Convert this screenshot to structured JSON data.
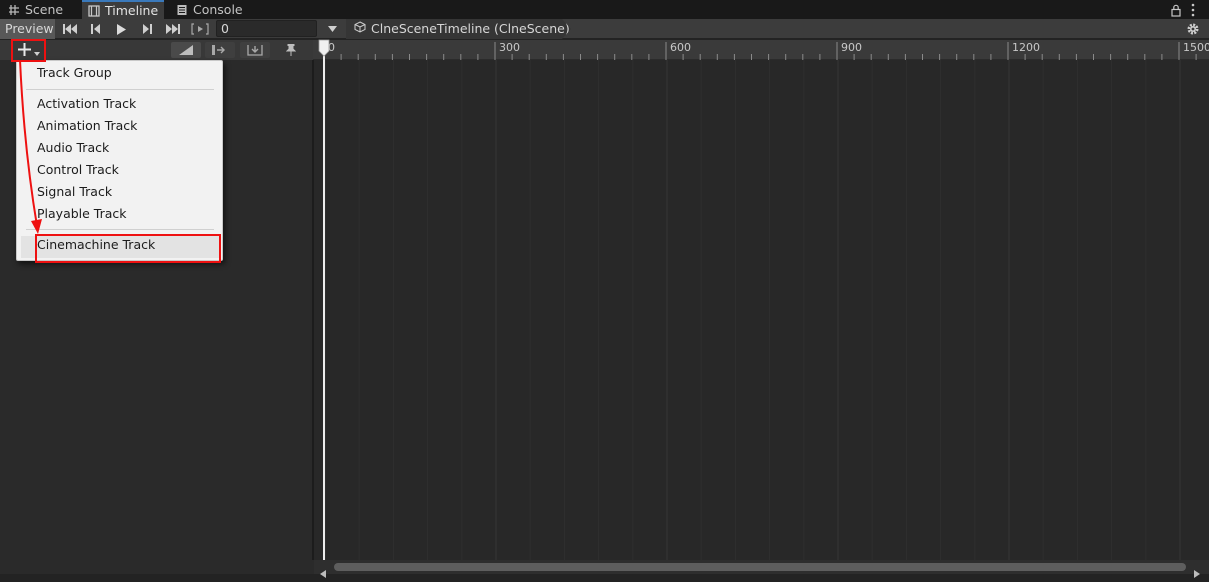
{
  "tabs": [
    {
      "label": "Scene",
      "icon": "grid-icon"
    },
    {
      "label": "Timeline",
      "icon": "film-icon",
      "active": true
    },
    {
      "label": "Console",
      "icon": "console-icon"
    }
  ],
  "toolbar": {
    "preview_label": "Preview",
    "frame_value": "0",
    "breadcrumb": "ClneSceneTimeline (ClneScene)",
    "icons": [
      "go-to-start-icon",
      "previous-frame-icon",
      "play-icon",
      "next-frame-icon",
      "go-to-end-icon",
      "play-range-icon",
      "dropdown-arrow-icon",
      "cube-icon",
      "gear-icon"
    ]
  },
  "ruler": {
    "ticks": [
      "0",
      "300",
      "600",
      "900",
      "1200",
      "1500"
    ]
  },
  "menu": {
    "group_item": "Track Group",
    "items": [
      "Activation Track",
      "Animation Track",
      "Audio Track",
      "Control Track",
      "Signal Track",
      "Playable Track"
    ],
    "highlighted_item": "Cinemachine Track"
  },
  "colors": {
    "accent": "#3a79bb",
    "annotation": "#e11111",
    "menu_bg": "#f2f2f2",
    "panel_bg": "#282828"
  }
}
